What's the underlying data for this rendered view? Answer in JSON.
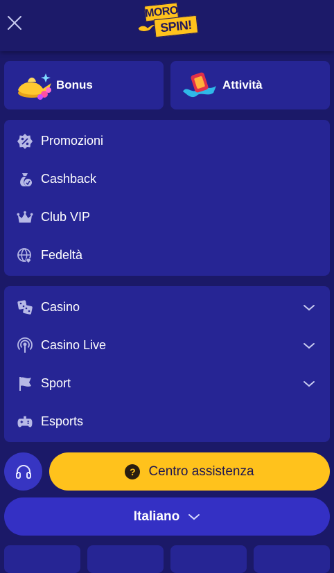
{
  "colors": {
    "background": "#1b1968",
    "panel": "#262594",
    "accent": "#ffc21c",
    "language_button": "#3430c4",
    "icon": "#b7b9e6"
  },
  "header": {
    "close_icon": "close-icon",
    "logo": {
      "line1": "MORO",
      "line2": "SPIN!"
    }
  },
  "tiles": [
    {
      "label": "Bonus",
      "icon": "genie-lamp-icon"
    },
    {
      "label": "Attività",
      "icon": "magic-carpet-icon"
    }
  ],
  "promo_menu": {
    "items": [
      {
        "label": "Promozioni",
        "icon": "percent-badge-icon"
      },
      {
        "label": "Cashback",
        "icon": "money-bag-icon"
      },
      {
        "label": "Club VIP",
        "icon": "crown-icon"
      },
      {
        "label": "Fedeltà",
        "icon": "globe-diamond-icon"
      }
    ]
  },
  "games_menu": {
    "items": [
      {
        "label": "Casino",
        "icon": "dice-icon",
        "expandable": true
      },
      {
        "label": "Casino Live",
        "icon": "live-broadcast-icon",
        "expandable": true
      },
      {
        "label": "Sport",
        "icon": "sport-flag-icon",
        "expandable": true
      },
      {
        "label": "Esports",
        "icon": "gamepad-icon",
        "expandable": false
      }
    ]
  },
  "support": {
    "icon": "headset-icon",
    "help_label": "Centro assistenza",
    "help_icon": "question-circle-icon"
  },
  "language": {
    "label": "Italiano",
    "icon": "chevron-down-icon"
  }
}
